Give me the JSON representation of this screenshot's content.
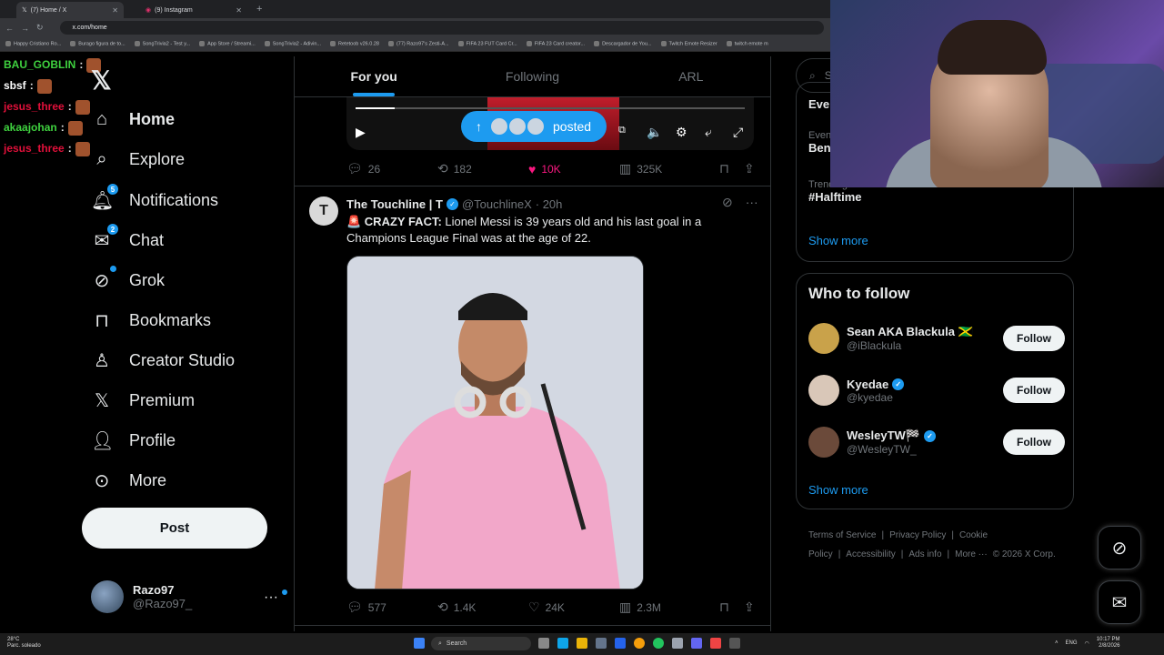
{
  "browser": {
    "tabs": [
      {
        "label": "(7) Home / X",
        "active": true
      },
      {
        "label": "(9) Instagram",
        "active": false
      }
    ],
    "url": "x.com/home",
    "bookmarks": [
      "Happy Cristiano Ro...",
      "Burago figura de to...",
      "SongTrivia2 - Test y...",
      "App Store / Streami...",
      "SongTrivia2 - Adivin...",
      "Retetoob v26.0.28",
      "(77) Razo97's Zesti-A...",
      "FIFA 23 FUT Card Cr...",
      "FIFA 23 Card creator...",
      "Descargador de You...",
      "Twitch Emote Resizer",
      "twitch emote m"
    ]
  },
  "chat": [
    {
      "user": "BAU_GOBLIN",
      "color": "#3fd13f"
    },
    {
      "user": "sbsf",
      "color": "#ffffff"
    },
    {
      "user": "jesus_three",
      "color": "#e0103a"
    },
    {
      "user": "akaajohan",
      "color": "#3fd13f"
    },
    {
      "user": "jesus_three",
      "color": "#e0103a"
    }
  ],
  "nav": {
    "items": [
      {
        "label": "Home",
        "icon": "home-icon"
      },
      {
        "label": "Explore",
        "icon": "search-icon"
      },
      {
        "label": "Notifications",
        "icon": "bell-icon",
        "badge": "5"
      },
      {
        "label": "Chat",
        "icon": "mail-icon",
        "badge": "2"
      },
      {
        "label": "Grok",
        "icon": "grok-icon"
      },
      {
        "label": "Bookmarks",
        "icon": "bookmark-icon"
      },
      {
        "label": "Creator Studio",
        "icon": "creator-icon"
      },
      {
        "label": "Premium",
        "icon": "x-icon"
      },
      {
        "label": "Profile",
        "icon": "person-icon"
      },
      {
        "label": "More",
        "icon": "more-circle-icon"
      }
    ],
    "post_label": "Post",
    "account_name": "Razo97",
    "account_handle": "@Razo97_"
  },
  "feed": {
    "tabs": [
      "For you",
      "Following",
      "ARL"
    ],
    "video_progress": 0.1,
    "posted_label": "posted",
    "prev_stats": {
      "replies": "26",
      "reposts": "182",
      "likes": "10K",
      "views": "325K"
    },
    "tweet": {
      "name": "The Touchline | T",
      "handle": "@TouchlineX",
      "time": "· 20h",
      "avatar_letter": "T",
      "text_prefix": "🚨 CRAZY FACT:",
      "text": " Lionel Messi is 39 years old and his last goal in a Champions League Final was at the age of 22.",
      "stats": {
        "replies": "577",
        "reposts": "1.4K",
        "likes": "24K",
        "views": "2.3M"
      }
    }
  },
  "right": {
    "search_placeholder": "Se",
    "trends": [
      {
        "small": "",
        "big": "Evel"
      },
      {
        "small": "Even",
        "big": "Ben"
      },
      {
        "small": "Trending in Mexico",
        "big": "#Halftime"
      }
    ],
    "trends_show_more": "Show more",
    "wtf_title": "Who to follow",
    "who_to_follow": [
      {
        "name": "Sean AKA Blackula 🇯🇲",
        "handle": "@iBlackula",
        "verified": false,
        "avatar": "#c9a24a"
      },
      {
        "name": "Kyedae",
        "handle": "@kyedae",
        "verified": true,
        "avatar": "#d9c7b8"
      },
      {
        "name": "WesleyTW🏁",
        "handle": "@WesleyTW_",
        "verified": true,
        "avatar": "#6b4a3a"
      }
    ],
    "follow_label": "Follow",
    "wtf_show_more": "Show more",
    "footer": [
      "Terms of Service",
      "|",
      "Privacy Policy",
      "|",
      "Cookie Policy",
      "|",
      "Accessibility",
      "|",
      "Ads info",
      "|",
      "More ···",
      "© 2026 X Corp."
    ]
  },
  "taskbar": {
    "weather_temp": "28°C",
    "weather_desc": "Parc. soleado",
    "search": "Search",
    "lang": "ENG",
    "time": "10:17 PM",
    "date": "2/8/2026"
  }
}
